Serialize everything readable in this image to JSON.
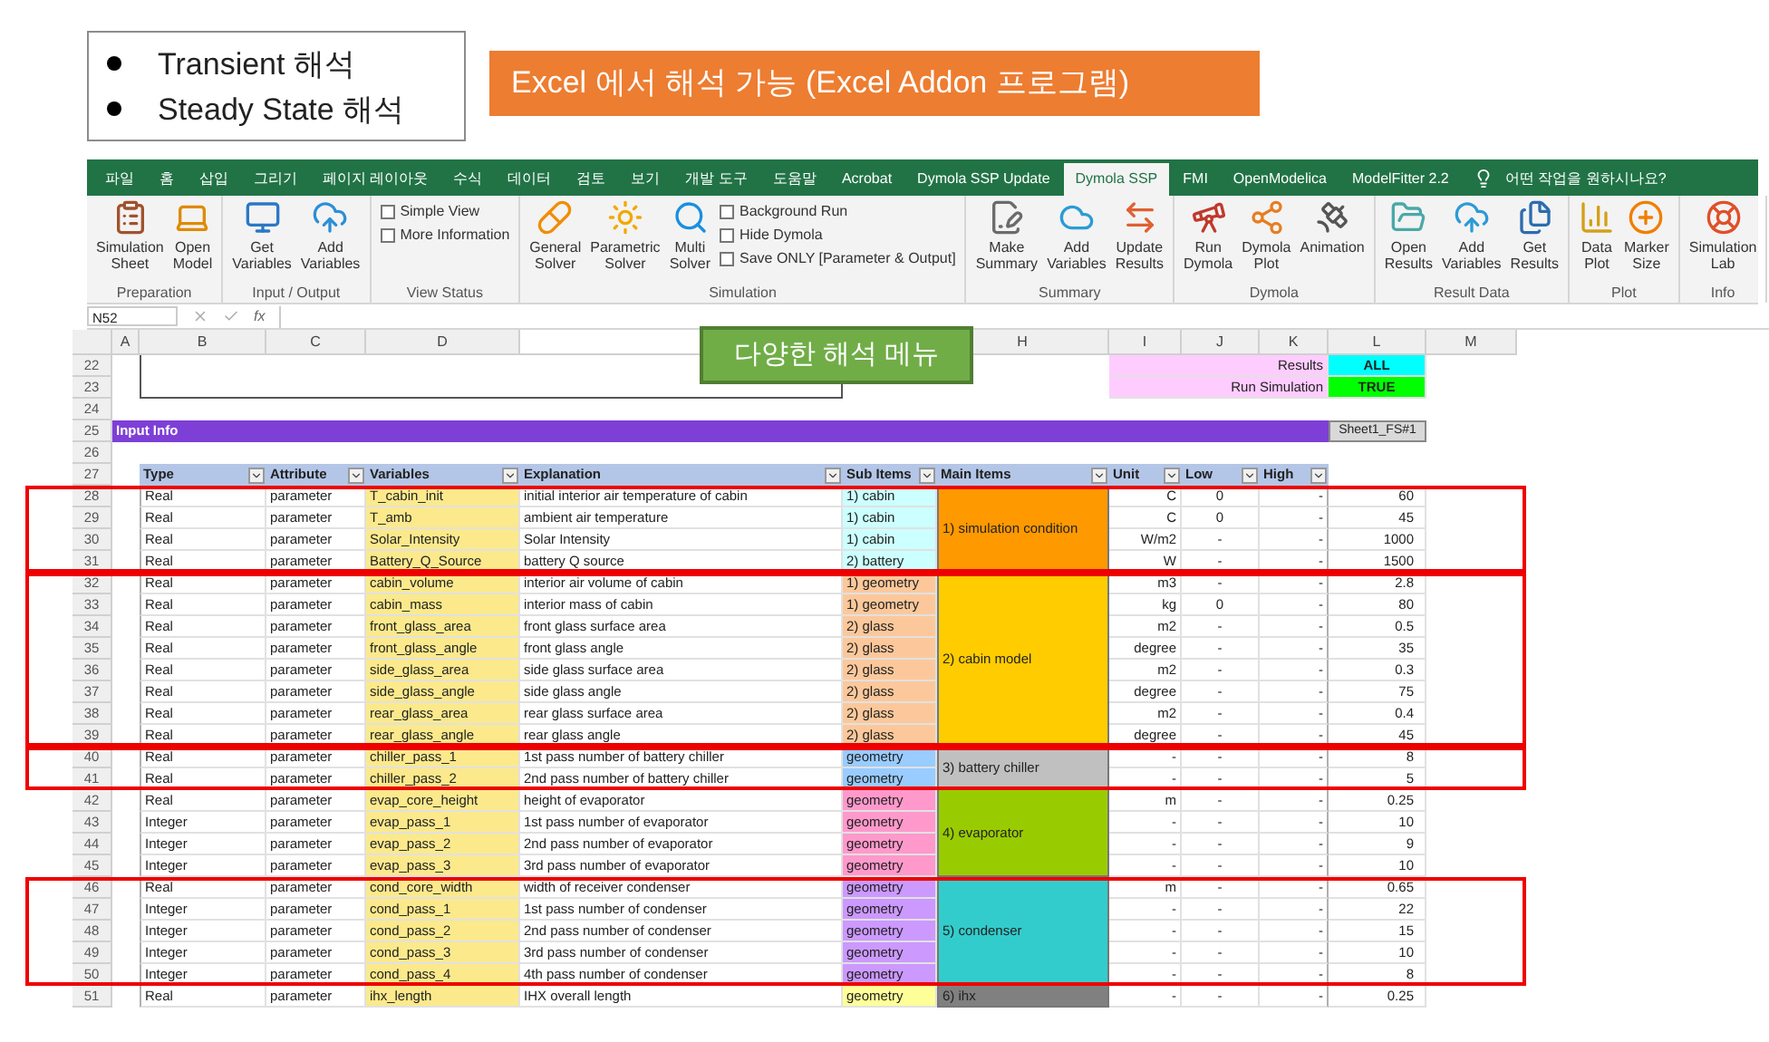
{
  "intro": {
    "bullets": [
      "Transient 해석",
      "Steady State 해석"
    ],
    "banner": "Excel 에서 해석 가능 (Excel Addon 프로그램)"
  },
  "ribbon": {
    "tabs": [
      {
        "label": "파일",
        "selected": false
      },
      {
        "label": "홈",
        "selected": false
      },
      {
        "label": "삽입",
        "selected": false
      },
      {
        "label": "그리기",
        "selected": false
      },
      {
        "label": "페이지 레이아웃",
        "selected": false
      },
      {
        "label": "수식",
        "selected": false
      },
      {
        "label": "데이터",
        "selected": false
      },
      {
        "label": "검토",
        "selected": false
      },
      {
        "label": "보기",
        "selected": false
      },
      {
        "label": "개발 도구",
        "selected": false
      },
      {
        "label": "도움말",
        "selected": false
      },
      {
        "label": "Acrobat",
        "selected": false
      },
      {
        "label": "Dymola SSP Update",
        "selected": false
      },
      {
        "label": "Dymola SSP",
        "selected": true
      },
      {
        "label": "FMI",
        "selected": false
      },
      {
        "label": "OpenModelica",
        "selected": false
      },
      {
        "label": "ModelFitter 2.2",
        "selected": false
      }
    ],
    "tell_me": "어떤 작업을 원하시나요?",
    "groups": [
      {
        "label": "Preparation",
        "items": [
          {
            "kind": "button",
            "label": "Simulation\nSheet"
          },
          {
            "kind": "button",
            "label": "Open\nModel"
          }
        ]
      },
      {
        "label": "Input / Output",
        "items": [
          {
            "kind": "button",
            "label": "Get\nVariables"
          },
          {
            "kind": "button",
            "label": "Add\nVariables"
          }
        ]
      },
      {
        "label": "View Status",
        "items": [
          {
            "kind": "checkbox",
            "label": "Simple View",
            "checked": false
          },
          {
            "kind": "checkbox",
            "label": "More Information",
            "checked": false
          }
        ]
      },
      {
        "label": "Simulation",
        "items": [
          {
            "kind": "button",
            "label": "General\nSolver"
          },
          {
            "kind": "button",
            "label": "Parametric\nSolver"
          },
          {
            "kind": "button",
            "label": "Multi\nSolver"
          },
          {
            "kind": "checkbox",
            "label": "Background Run",
            "checked": false
          },
          {
            "kind": "checkbox",
            "label": "Hide Dymola",
            "checked": false
          },
          {
            "kind": "checkbox",
            "label": "Save ONLY [Parameter & Output]",
            "checked": false
          }
        ]
      },
      {
        "label": "Summary",
        "items": [
          {
            "kind": "button",
            "label": "Make\nSummary"
          },
          {
            "kind": "button",
            "label": "Add\nVariables"
          },
          {
            "kind": "button",
            "label": "Update\nResults"
          }
        ]
      },
      {
        "label": "Dymola",
        "items": [
          {
            "kind": "button",
            "label": "Run\nDymola"
          },
          {
            "kind": "button",
            "label": "Dymola\nPlot"
          },
          {
            "kind": "button",
            "label": "Animation"
          }
        ]
      },
      {
        "label": "Result Data",
        "items": [
          {
            "kind": "button",
            "label": "Open\nResults"
          },
          {
            "kind": "button",
            "label": "Add\nVariables"
          },
          {
            "kind": "button",
            "label": "Get\nResults"
          }
        ]
      },
      {
        "label": "Plot",
        "items": [
          {
            "kind": "button",
            "label": "Data\nPlot"
          },
          {
            "kind": "button",
            "label": "Marker\nSize"
          }
        ]
      },
      {
        "label": "Info",
        "items": [
          {
            "kind": "button",
            "label": "Simulation\nLab"
          }
        ]
      }
    ]
  },
  "formula_bar": {
    "name_box": "N52",
    "function_label": "fx"
  },
  "callout": "다양한 해석 메뉴",
  "sheet": {
    "column_letters": [
      "A",
      "B",
      "C",
      "D",
      "H",
      "I",
      "J",
      "K",
      "L",
      "M"
    ],
    "settings_rows": [
      {
        "row": "22",
        "label": "Results",
        "value": "ALL",
        "color": "#00ffff"
      },
      {
        "row": "23",
        "label": "Run Simulation",
        "value": "TRUE",
        "color": "#00ff00"
      }
    ],
    "empty_row": "24",
    "section": {
      "row": "25",
      "title": "Input Info",
      "sheet_button": "Sheet1_FS#1"
    },
    "blank_row": "26",
    "header": {
      "row": "27",
      "columns": [
        "Type",
        "Attribute",
        "Variables",
        "Explanation",
        "Sub Items",
        "Main Items",
        "Unit",
        "Low",
        "High"
      ]
    },
    "groups": [
      {
        "main_item": "1) simulation condition",
        "color": "#ff9900",
        "highlighted": true,
        "rows": [
          {
            "row": "28",
            "type": "Real",
            "attribute": "parameter",
            "variable": "T_cabin_init",
            "explanation": "initial interior air temperature of cabin",
            "sub_item": {
              "label": "1) cabin",
              "color": "#ccffff"
            },
            "unit": "C",
            "low": "0",
            "high": "-",
            "value": "60"
          },
          {
            "row": "29",
            "type": "Real",
            "attribute": "parameter",
            "variable": "T_amb",
            "explanation": "ambient air temperature",
            "sub_item": {
              "label": "1) cabin",
              "color": "#ccffff"
            },
            "unit": "C",
            "low": "0",
            "high": "-",
            "value": "45"
          },
          {
            "row": "30",
            "type": "Real",
            "attribute": "parameter",
            "variable": "Solar_Intensity",
            "explanation": "Solar Intensity",
            "sub_item": {
              "label": "1) cabin",
              "color": "#ccffff"
            },
            "unit": "W/m2",
            "low": "-",
            "high": "-",
            "value": "1000"
          },
          {
            "row": "31",
            "type": "Real",
            "attribute": "parameter",
            "variable": "Battery_Q_Source",
            "explanation": "battery Q source",
            "sub_item": {
              "label": "2) battery",
              "color": "#ccffff"
            },
            "unit": "W",
            "low": "-",
            "high": "-",
            "value": "1500"
          }
        ]
      },
      {
        "main_item": "2) cabin model",
        "color": "#ffcc00",
        "highlighted": true,
        "rows": [
          {
            "row": "32",
            "type": "Real",
            "attribute": "parameter",
            "variable": "cabin_volume",
            "explanation": "interior air volume of cabin",
            "sub_item": {
              "label": "1) geometry",
              "color": "#fcc89b"
            },
            "unit": "m3",
            "low": "-",
            "high": "-",
            "value": "2.8"
          },
          {
            "row": "33",
            "type": "Real",
            "attribute": "parameter",
            "variable": "cabin_mass",
            "explanation": "interior mass of cabin",
            "sub_item": {
              "label": "1) geometry",
              "color": "#fcc89b"
            },
            "unit": "kg",
            "low": "0",
            "high": "-",
            "value": "80"
          },
          {
            "row": "34",
            "type": "Real",
            "attribute": "parameter",
            "variable": "front_glass_area",
            "explanation": "front glass surface area",
            "sub_item": {
              "label": "2) glass",
              "color": "#fcc89b"
            },
            "unit": "m2",
            "low": "-",
            "high": "-",
            "value": "0.5"
          },
          {
            "row": "35",
            "type": "Real",
            "attribute": "parameter",
            "variable": "front_glass_angle",
            "explanation": "front glass angle",
            "sub_item": {
              "label": "2) glass",
              "color": "#fcc89b"
            },
            "unit": "degree",
            "low": "-",
            "high": "-",
            "value": "35"
          },
          {
            "row": "36",
            "type": "Real",
            "attribute": "parameter",
            "variable": "side_glass_area",
            "explanation": "side glass surface area",
            "sub_item": {
              "label": "2) glass",
              "color": "#fcc89b"
            },
            "unit": "m2",
            "low": "-",
            "high": "-",
            "value": "0.3"
          },
          {
            "row": "37",
            "type": "Real",
            "attribute": "parameter",
            "variable": "side_glass_angle",
            "explanation": "side glass angle",
            "sub_item": {
              "label": "2) glass",
              "color": "#fcc89b"
            },
            "unit": "degree",
            "low": "-",
            "high": "-",
            "value": "75"
          },
          {
            "row": "38",
            "type": "Real",
            "attribute": "parameter",
            "variable": "rear_glass_area",
            "explanation": "rear glass surface area",
            "sub_item": {
              "label": "2) glass",
              "color": "#fcc89b"
            },
            "unit": "m2",
            "low": "-",
            "high": "-",
            "value": "0.4"
          },
          {
            "row": "39",
            "type": "Real",
            "attribute": "parameter",
            "variable": "rear_glass_angle",
            "explanation": "rear glass angle",
            "sub_item": {
              "label": "2) glass",
              "color": "#fcc89b"
            },
            "unit": "degree",
            "low": "-",
            "high": "-",
            "value": "45"
          }
        ]
      },
      {
        "main_item": "3) battery chiller",
        "color": "#c0c0c0",
        "highlighted": true,
        "rows": [
          {
            "row": "40",
            "type": "Real",
            "attribute": "parameter",
            "variable": "chiller_pass_1",
            "explanation": "1st pass number of battery chiller",
            "sub_item": {
              "label": "geometry",
              "color": "#99ccff"
            },
            "unit": "-",
            "low": "-",
            "high": "-",
            "value": "8"
          },
          {
            "row": "41",
            "type": "Real",
            "attribute": "parameter",
            "variable": "chiller_pass_2",
            "explanation": "2nd pass number of battery chiller",
            "sub_item": {
              "label": "geometry",
              "color": "#99ccff"
            },
            "unit": "-",
            "low": "-",
            "high": "-",
            "value": "5"
          }
        ]
      },
      {
        "main_item": "4) evaporator",
        "color": "#99cc00",
        "highlighted": false,
        "rows": [
          {
            "row": "42",
            "type": "Real",
            "attribute": "parameter",
            "variable": "evap_core_height",
            "explanation": "height of evaporator",
            "sub_item": {
              "label": "geometry",
              "color": "#ff99cc"
            },
            "unit": "m",
            "low": "-",
            "high": "-",
            "value": "0.25"
          },
          {
            "row": "43",
            "type": "Integer",
            "attribute": "parameter",
            "variable": "evap_pass_1",
            "explanation": "1st pass number of evaporator",
            "sub_item": {
              "label": "geometry",
              "color": "#ff99cc"
            },
            "unit": "-",
            "low": "-",
            "high": "-",
            "value": "10"
          },
          {
            "row": "44",
            "type": "Integer",
            "attribute": "parameter",
            "variable": "evap_pass_2",
            "explanation": "2nd pass number of evaporator",
            "sub_item": {
              "label": "geometry",
              "color": "#ff99cc"
            },
            "unit": "-",
            "low": "-",
            "high": "-",
            "value": "9"
          },
          {
            "row": "45",
            "type": "Integer",
            "attribute": "parameter",
            "variable": "evap_pass_3",
            "explanation": "3rd pass number of evaporator",
            "sub_item": {
              "label": "geometry",
              "color": "#ff99cc"
            },
            "unit": "-",
            "low": "-",
            "high": "-",
            "value": "10"
          }
        ]
      },
      {
        "main_item": "5) condenser",
        "color": "#33cccc",
        "highlighted": true,
        "rows": [
          {
            "row": "46",
            "type": "Real",
            "attribute": "parameter",
            "variable": "cond_core_width",
            "explanation": "width of receiver condenser",
            "sub_item": {
              "label": "geometry",
              "color": "#cc99ff"
            },
            "unit": "m",
            "low": "-",
            "high": "-",
            "value": "0.65"
          },
          {
            "row": "47",
            "type": "Integer",
            "attribute": "parameter",
            "variable": "cond_pass_1",
            "explanation": "1st pass number of condenser",
            "sub_item": {
              "label": "geometry",
              "color": "#cc99ff"
            },
            "unit": "-",
            "low": "-",
            "high": "-",
            "value": "22"
          },
          {
            "row": "48",
            "type": "Integer",
            "attribute": "parameter",
            "variable": "cond_pass_2",
            "explanation": "2nd pass number of condenser",
            "sub_item": {
              "label": "geometry",
              "color": "#cc99ff"
            },
            "unit": "-",
            "low": "-",
            "high": "-",
            "value": "15"
          },
          {
            "row": "49",
            "type": "Integer",
            "attribute": "parameter",
            "variable": "cond_pass_3",
            "explanation": "3rd pass number of condenser",
            "sub_item": {
              "label": "geometry",
              "color": "#cc99ff"
            },
            "unit": "-",
            "low": "-",
            "high": "-",
            "value": "10"
          },
          {
            "row": "50",
            "type": "Integer",
            "attribute": "parameter",
            "variable": "cond_pass_4",
            "explanation": "4th pass number of condenser",
            "sub_item": {
              "label": "geometry",
              "color": "#cc99ff"
            },
            "unit": "-",
            "low": "-",
            "high": "-",
            "value": "8"
          }
        ]
      },
      {
        "main_item": "6) ihx",
        "color": "#808080",
        "highlighted": false,
        "rows": [
          {
            "row": "51",
            "type": "Real",
            "attribute": "parameter",
            "variable": "ihx_length",
            "explanation": "IHX overall length",
            "sub_item": {
              "label": "geometry",
              "color": "#ffff99"
            },
            "unit": "-",
            "low": "-",
            "high": "-",
            "value": "0.25"
          }
        ]
      }
    ]
  }
}
